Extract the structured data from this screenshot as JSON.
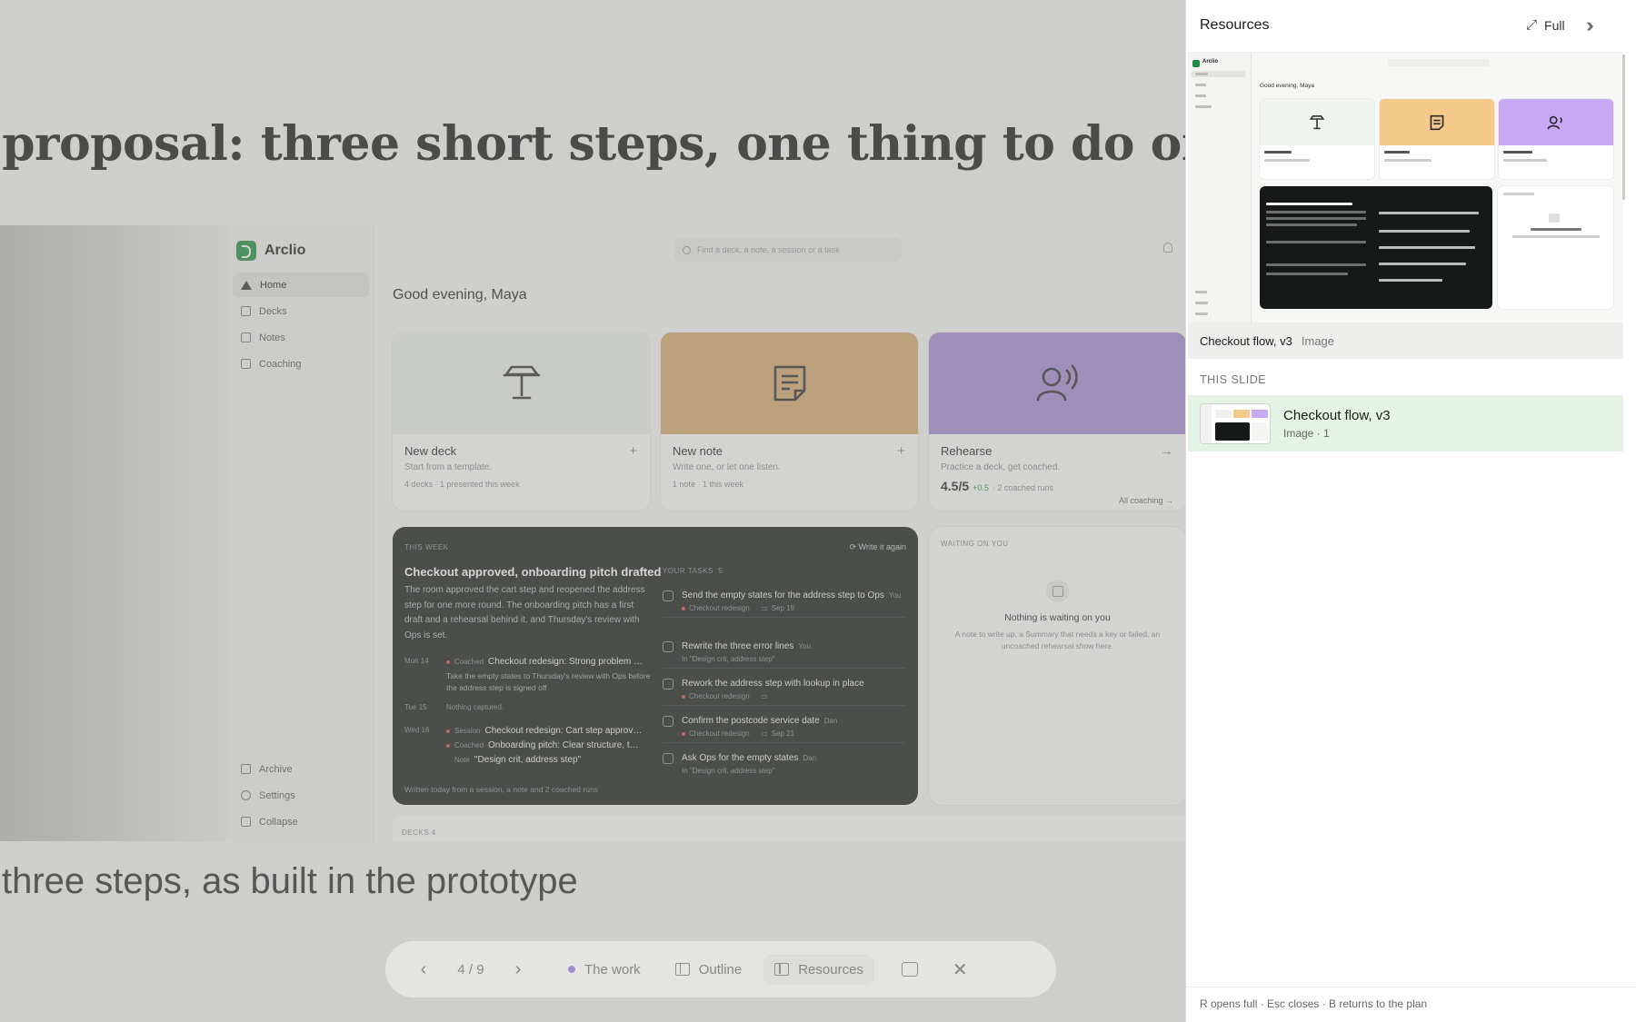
{
  "slide": {
    "title": "e proposal: three short steps, one thing to do on eac",
    "caption": "three steps, as built in the prototype"
  },
  "app": {
    "name": "Arclio",
    "search_placeholder": "Find a deck, a note, a session or a task",
    "nav": [
      "Home",
      "Decks",
      "Notes",
      "Coaching"
    ],
    "nav_bottom": [
      "Archive",
      "Settings",
      "Collapse"
    ],
    "greeting": "Good evening, Maya",
    "cards": [
      {
        "title": "New deck",
        "subtitle": "Start from a template.",
        "meta": "4 decks · 1 presented this week",
        "action": "+",
        "color": "#eef1ee"
      },
      {
        "title": "New note",
        "subtitle": "Write one, or let one listen.",
        "meta": "1 note · 1 this week",
        "action": "+",
        "color": "#d7aa6d"
      },
      {
        "title": "Rehearse",
        "subtitle": "Practice a deck, get coached.",
        "score": "4.5/5",
        "delta": "+0.5",
        "runs": "· 2 coached runs",
        "link": "All coaching →",
        "action": "→",
        "color": "#a58ad6"
      }
    ],
    "week": {
      "label": "THIS WEEK",
      "write_again": "⟳  Write it again",
      "headline": "Checkout approved, onboarding pitch drafted",
      "summary": "The room approved the cart step and reopened the address step for one more round. The onboarding pitch has a first draft and a rehearsal behind it, and Thursday's review with Ops is set.",
      "timeline": [
        {
          "date": "Mon 14",
          "kind": "Coached",
          "text": "Checkout redesign: Strong problem …",
          "note": "Take the empty states to Thursday's review with Ops before the address step is signed off"
        },
        {
          "date": "Tue 15",
          "kind": "",
          "text": "Nothing captured."
        },
        {
          "date": "Wed 16",
          "kind": "Session",
          "text": "Checkout redesign: Cart step approv…"
        },
        {
          "date": "",
          "kind": "Coached",
          "text": "Onboarding pitch: Clear structure, t…"
        },
        {
          "date": "",
          "kind": "Note",
          "text": "\"Design crit, address step\""
        }
      ],
      "footer": "Written today from a session, a note and 2 coached runs",
      "tasks_label": "YOUR TASKS",
      "tasks_count": "5",
      "tasks": [
        {
          "title": "Send the empty states for the address step to Ops",
          "who": "You",
          "meta": "Checkout redesign",
          "date": "Sep 19"
        },
        {
          "title": "Rewrite the three error lines",
          "who": "You",
          "meta": "In \"Design crit, address step\"",
          "date": ""
        },
        {
          "title": "Rework the address step with lookup in place",
          "who": "",
          "meta": "Checkout redesign",
          "date": ""
        },
        {
          "title": "Confirm the postcode service date",
          "who": "Dan",
          "meta": "Checkout redesign",
          "date": "Sep 21"
        },
        {
          "title": "Ask Ops for the empty states",
          "who": "Dan",
          "meta": "In \"Design crit, address step\"",
          "date": ""
        }
      ]
    },
    "waiting": {
      "label": "WAITING ON YOU",
      "headline": "Nothing is waiting on you",
      "body": "A note to write up, a Summary that needs a key or failed, an uncoached rehearsal show here."
    },
    "decks_label": "DECKS  4"
  },
  "pager": {
    "position": "4 / 9",
    "section": "The work",
    "outline": "Outline",
    "resources": "Resources"
  },
  "panel": {
    "title": "Resources",
    "full": "Full",
    "preview_caption": {
      "name": "Checkout flow, v3",
      "type": "Image"
    },
    "section": "THIS SLIDE",
    "item": {
      "name": "Checkout flow, v3",
      "meta": "Image · 1"
    },
    "footer": "R opens full · Esc closes · B returns to the plan"
  },
  "colors": {
    "accent": "#1e8e3e",
    "selected_row": "#e3f4e6",
    "dark_card": "#151a18"
  }
}
